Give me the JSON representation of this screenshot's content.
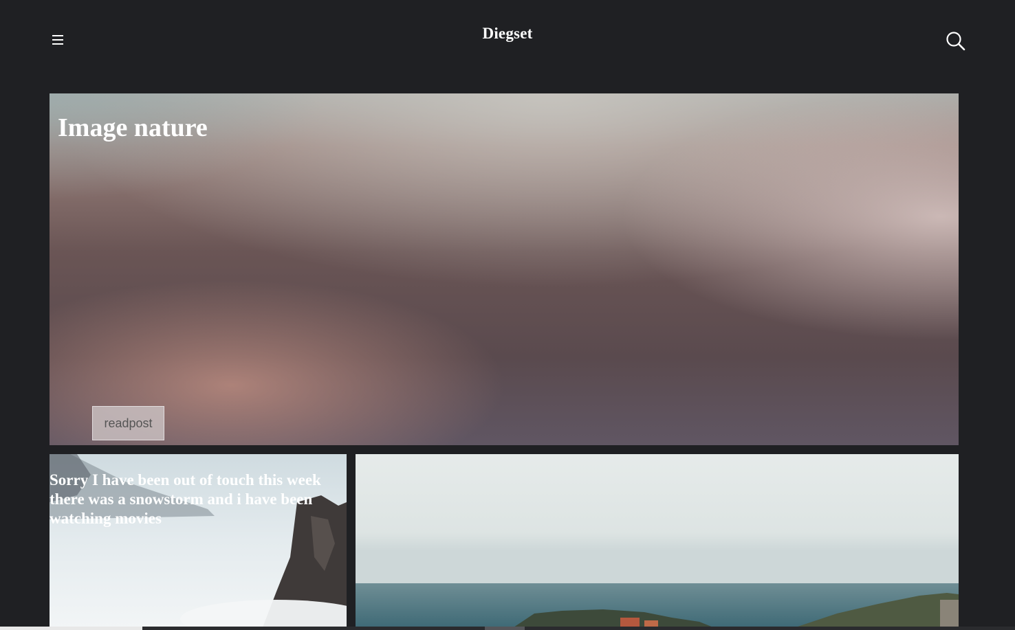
{
  "header": {
    "site_title": "Diegset",
    "menu_icon": "hamburger-menu-icon",
    "search_icon": "search-icon"
  },
  "hero": {
    "title": "Image nature",
    "read_button_label": "readpost"
  },
  "posts": [
    {
      "title": "Sorry I have been out of touch this week there was a snowstorm and i have been watching movies"
    },
    {
      "title": ""
    }
  ],
  "colors": {
    "page_background": "#1f2023",
    "text": "#ffffff"
  }
}
